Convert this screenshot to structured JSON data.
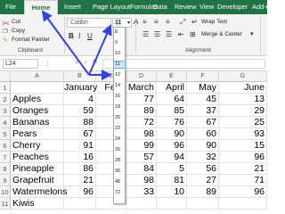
{
  "tabs": {
    "file": "File",
    "home": "Home",
    "insert": "Insert",
    "page_layout": "Page Layout",
    "formulas": "Formulas",
    "data": "Data",
    "review": "Review",
    "view": "View",
    "developer": "Developer",
    "addins": "Add-ins"
  },
  "clipboard": {
    "cut": "Cut",
    "copy": "Copy",
    "format_painter": "Format Painter",
    "label": "Clipboard"
  },
  "font": {
    "name": "Calibri",
    "size": "11"
  },
  "alignment": {
    "wrap_text": "Wrap Text",
    "merge_center": "Merge & Center",
    "label": "Alignment"
  },
  "formula_bar": {
    "name_box": "L24",
    "fx": "fx"
  },
  "font_size_options": [
    "8",
    "9",
    "10",
    "11",
    "12",
    "14",
    "16",
    "18",
    "20",
    "22",
    "24",
    "26",
    "28",
    "36",
    "48",
    "72"
  ],
  "sheet": {
    "columns": [
      "A",
      "B",
      "C",
      "D",
      "E",
      "F",
      "G"
    ],
    "rows": [
      {
        "num": "1",
        "name": "",
        "values": [
          "January",
          "Febr",
          "March",
          "April",
          "May",
          "June"
        ]
      },
      {
        "num": "2",
        "name": "Apples",
        "values": [
          "4",
          "",
          "77",
          "64",
          "45",
          "13"
        ]
      },
      {
        "num": "3",
        "name": "Oranges",
        "values": [
          "59",
          "",
          "89",
          "85",
          "37",
          "29"
        ]
      },
      {
        "num": "4",
        "name": "Bananas",
        "values": [
          "88",
          "",
          "72",
          "76",
          "67",
          "25"
        ]
      },
      {
        "num": "5",
        "name": "Pears",
        "values": [
          "67",
          "",
          "98",
          "90",
          "60",
          "93"
        ]
      },
      {
        "num": "6",
        "name": "Cherry",
        "values": [
          "91",
          "",
          "99",
          "96",
          "90",
          "15"
        ]
      },
      {
        "num": "7",
        "name": "Peaches",
        "values": [
          "16",
          "",
          "57",
          "94",
          "32",
          "96"
        ]
      },
      {
        "num": "8",
        "name": "Pineapple",
        "values": [
          "86",
          "",
          "84",
          "5",
          "56",
          "21"
        ]
      },
      {
        "num": "9",
        "name": "Grapefruit",
        "values": [
          "21",
          "",
          "98",
          "81",
          "27",
          "71"
        ]
      },
      {
        "num": "10",
        "name": "Watermelons",
        "values": [
          "96",
          "",
          "33",
          "10",
          "89",
          "96"
        ]
      },
      {
        "num": "11",
        "name": "Kiwis",
        "values": [
          "",
          "",
          "",
          "",
          "",
          ""
        ]
      }
    ]
  },
  "colors": {
    "ribbon_green": "#217346",
    "arrow_blue": "#3344dd",
    "selection_blue": "#cfe5f9"
  }
}
